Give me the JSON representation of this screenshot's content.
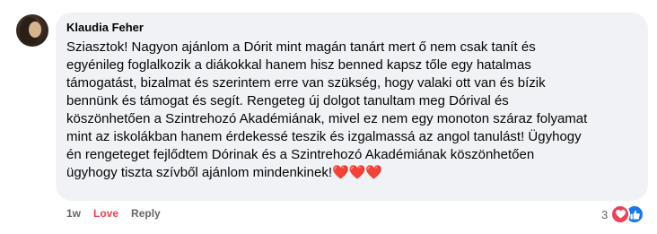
{
  "comment": {
    "author": "Klaudia Feher",
    "text": "Sziasztok! Nagyon ajánlom a Dórit mint magán tanárt mert ő nem csak tanít és\negyénileg foglalkozik a diákokkal hanem hisz benned kapsz tőle egy hatalmas\ntámogatást, bizalmat és szerintem erre van szükség, hogy valaki ott van és bízik\nbennünk és támogat és segít. Rengeteg új dolgot tanultam meg Dórival és\nköszönhetően a Szintrehozó Akadémiának, mivel ez nem egy monoton száraz folyamat\nmint az iskolákban hanem érdekessé teszik és izgalmassá az angol tanulást! Ügyhogy\nén rengeteget fejlődtem Dórinak és a Szintrehozó Akadémiának köszönhetően\nügyhogy tiszta szívből ajánlom mindenkinek!❤️❤️❤️",
    "time": "1w",
    "love_label": "Love",
    "reply_label": "Reply",
    "reaction_count": "3",
    "reaction_icons": [
      "heart-icon",
      "thumbs-up-icon"
    ],
    "colors": {
      "bubble": "#f0f2f5",
      "love": "#f33e58",
      "like": "#1877f2",
      "meta": "#65676b"
    }
  }
}
